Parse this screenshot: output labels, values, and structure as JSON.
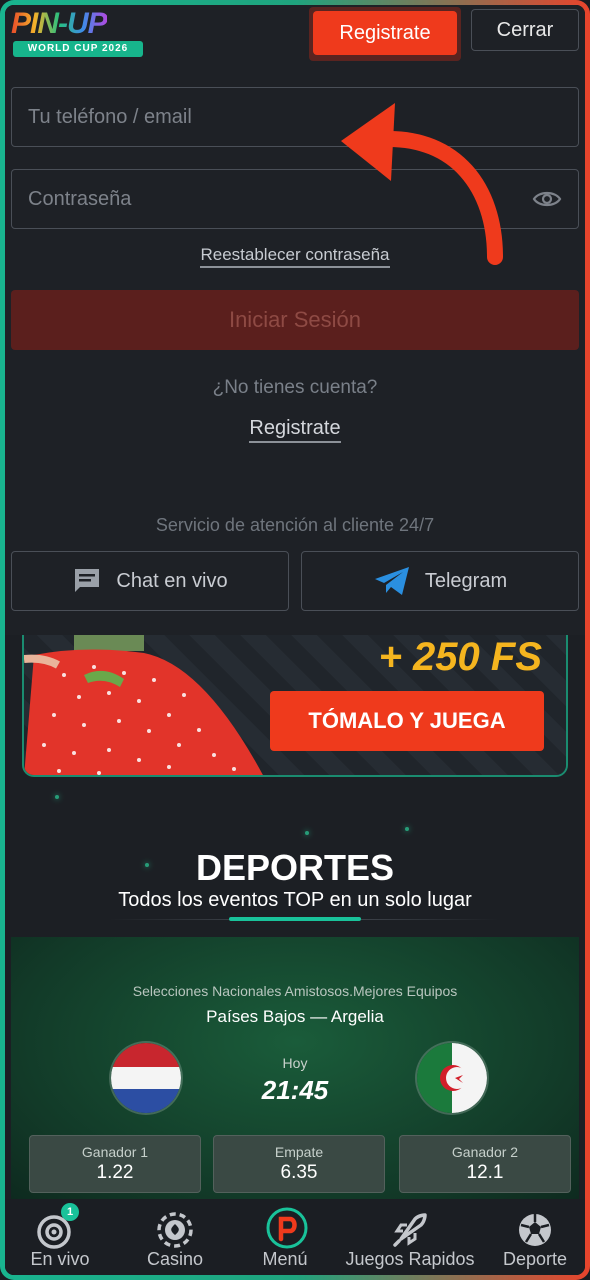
{
  "header": {
    "logo_text": "PIN-UP",
    "logo_badge": "WORLD CUP 2026",
    "register_label": "Registrate",
    "close_label": "Cerrar"
  },
  "login": {
    "phone_placeholder": "Tu teléfono / email",
    "password_placeholder": "Contraseña",
    "reset_label": "Reestablecer contraseña",
    "login_label": "Iniciar Sesión",
    "no_account_text": "¿No tienes cuenta?",
    "register_link": "Registrate",
    "support_text": "Servicio de atención al cliente 24/7",
    "chat_label": "Chat en vivo",
    "telegram_label": "Telegram"
  },
  "banner": {
    "fs_text": "+ 250 FS",
    "cta_label": "TÓMALO Y JUEGA"
  },
  "deportes": {
    "title": "DEPORTES",
    "subtitle": "Todos los eventos TOP en un solo lugar"
  },
  "match": {
    "league": "Selecciones Nacionales Amistosos.Mejores Equipos",
    "teams": "Países Bajos  —  Argelia",
    "day": "Hoy",
    "time": "21:45",
    "odds": [
      {
        "label": "Ganador 1",
        "value": "1.22"
      },
      {
        "label": "Empate",
        "value": "6.35"
      },
      {
        "label": "Ganador 2",
        "value": "12.1"
      }
    ]
  },
  "nav": {
    "items": [
      {
        "label": "En vivo",
        "badge": "1"
      },
      {
        "label": "Casino"
      },
      {
        "label": "Menú"
      },
      {
        "label": "Juegos Rapidos"
      },
      {
        "label": "Deporte"
      }
    ]
  },
  "colors": {
    "accent": "#ef3a1c",
    "brand_green": "#19c29a",
    "fs_yellow": "#f5b51f"
  }
}
